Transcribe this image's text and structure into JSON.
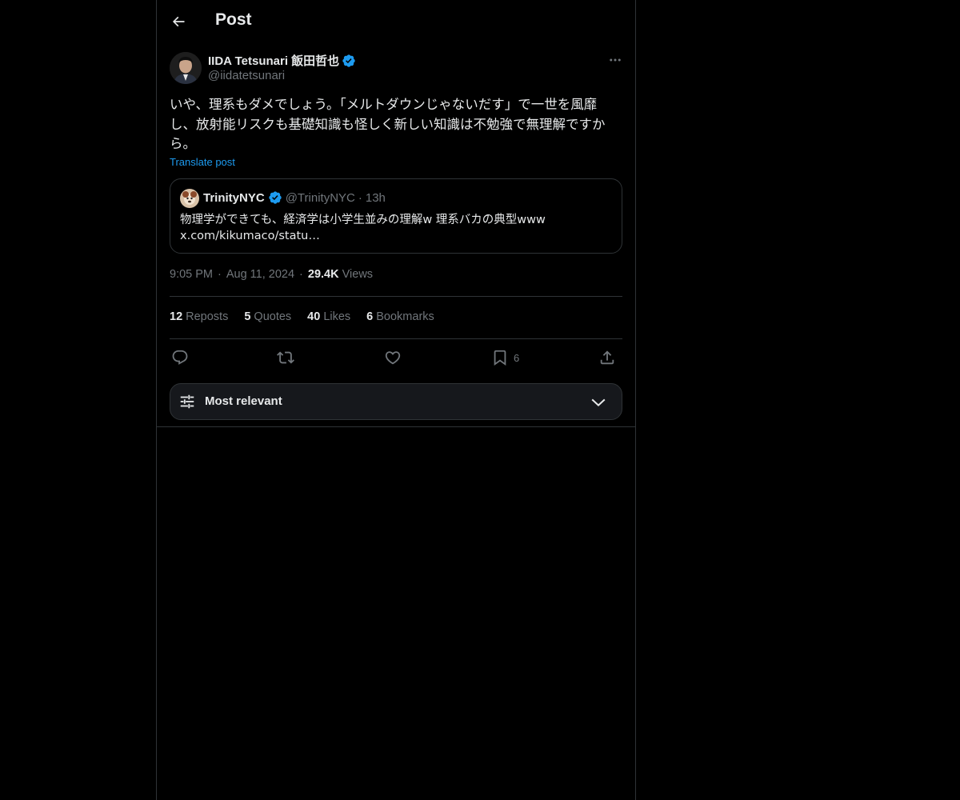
{
  "header": {
    "title": "Post",
    "back_icon": "arrow-left-icon"
  },
  "post": {
    "author_name": "IIDA Tetsunari 飯田哲也",
    "author_handle": "@iidatetsunari",
    "verified_icon": "verified-badge-icon",
    "more_icon": "more-horizontal-icon",
    "text": "いや、理系もダメでしょう。「メルトダウンじゃないだす」で一世を風靡し、放射能リスクも基礎知識も怪しく新しい知識は不勉強で無理解ですから。",
    "translate_label": "Translate post"
  },
  "quote": {
    "name": "TrinityNYC",
    "handle": "@TrinityNYC",
    "dot": "·",
    "time": "13h",
    "line1": "物理学ができても、経済学は小学生並みの理解w  理系バカの典型www",
    "line2": "x.com/kikumaco/statu…"
  },
  "meta": {
    "time": "9:05 PM",
    "sep1": "·",
    "date": "Aug 11, 2024",
    "sep2": "·",
    "views_count": "29.4K",
    "views_label": "Views"
  },
  "stats": {
    "reposts_count": "12",
    "reposts_label": "Reposts",
    "quotes_count": "5",
    "quotes_label": "Quotes",
    "likes_count": "40",
    "likes_label": "Likes",
    "bookmarks_count": "6",
    "bookmarks_label": "Bookmarks"
  },
  "actions": {
    "reply_icon": "reply-icon",
    "repost_icon": "repost-icon",
    "like_icon": "heart-icon",
    "bookmark_icon": "bookmark-icon",
    "bookmark_count": "6",
    "share_icon": "share-icon"
  },
  "sort": {
    "label": "Most relevant",
    "icon": "sliders-icon",
    "chevron": "chevron-down-icon"
  },
  "colors": {
    "background": "#000000",
    "accent": "#1d9bf0",
    "text": "#e7e9ea",
    "muted": "#71767b",
    "border": "#2f3336"
  }
}
